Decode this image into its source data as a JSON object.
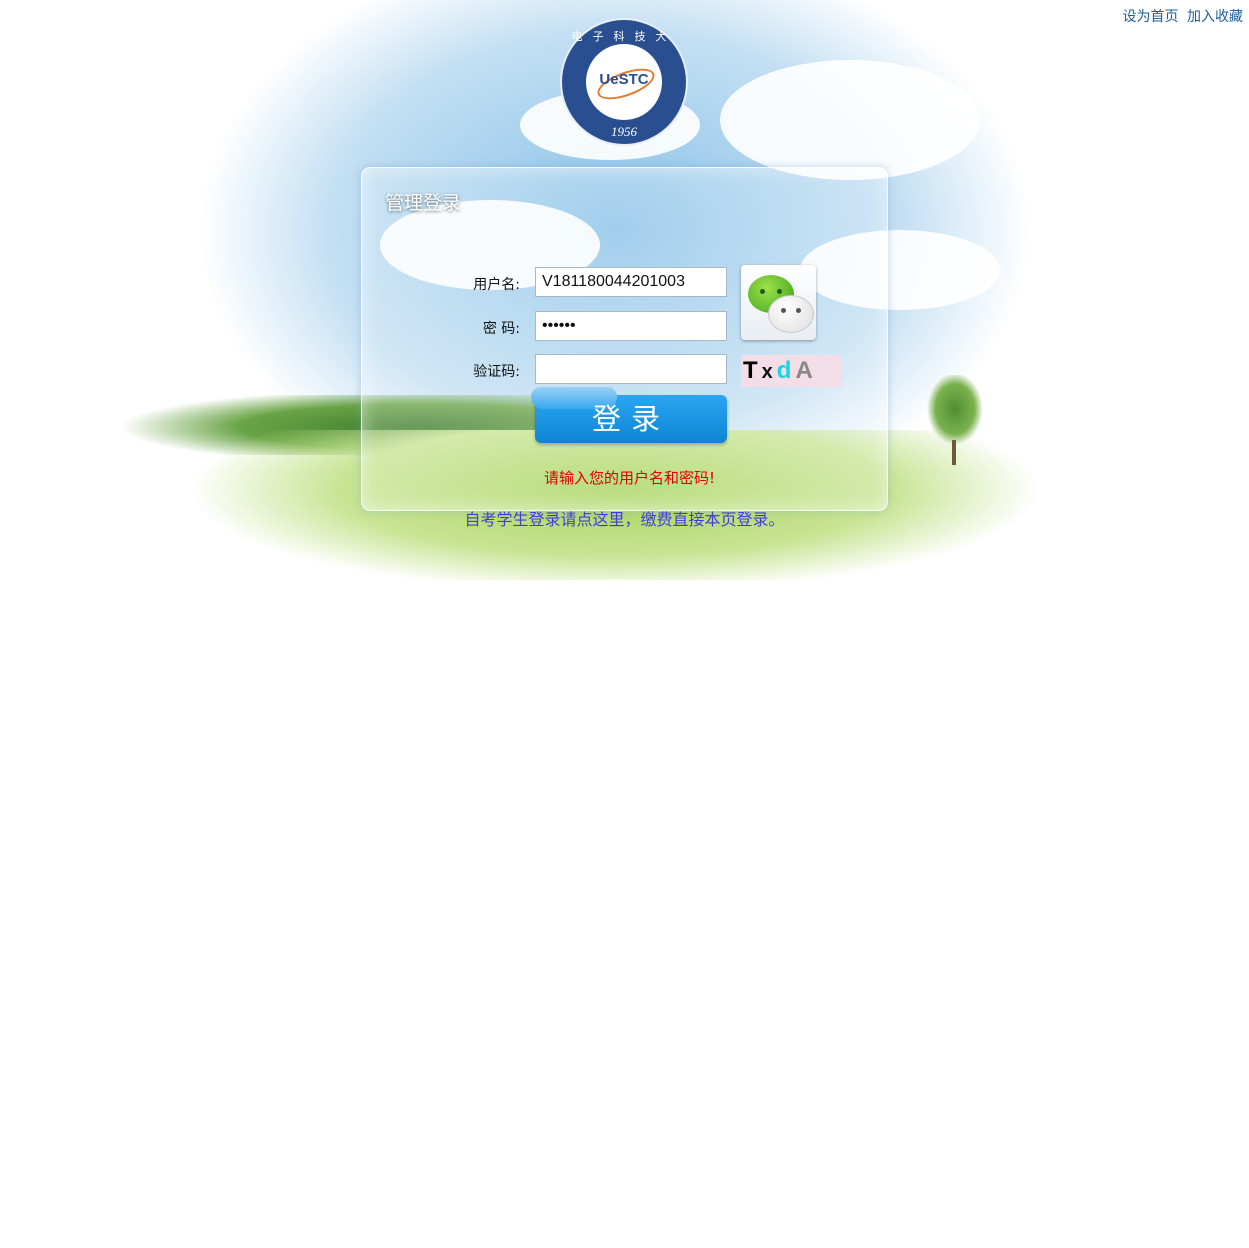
{
  "top_links": {
    "set_home": "设为首页",
    "add_favorite": "加入收藏"
  },
  "logo": {
    "mark": "UeSTC",
    "year": "1956",
    "ring_text": "电子科技大学"
  },
  "login": {
    "title": "管理登录",
    "username_label": "用户名:",
    "password_label": "密 码:",
    "captcha_label": "验证码:",
    "username_value": "V181180044201003",
    "password_value": "••••••",
    "captcha_value": "",
    "captcha_text": {
      "c1": "T",
      "c2": "x",
      "c3": "d",
      "c4": "A"
    },
    "login_button": "登录",
    "error_message": "请输入您的用户名和密码!"
  },
  "student_link": "自考学生登录请点这里，缴费直接本页登录。",
  "colors": {
    "link": "#1d5f9e",
    "error": "#e00000",
    "login_button": "#1695e3",
    "student_link": "#3f3fd6"
  },
  "icons": {
    "wechat": "wechat-icon"
  }
}
